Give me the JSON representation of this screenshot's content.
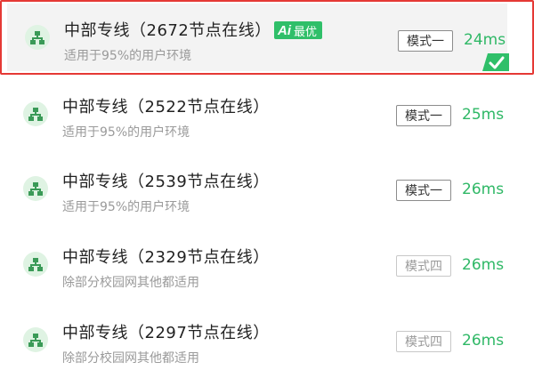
{
  "accent_color": "#2fb866",
  "selected_border_color": "#e53935",
  "lines": [
    {
      "title": "中部专线（2672节点在线）",
      "subtitle": "适用于95%的用户环境",
      "badge": {
        "mark": "Ai",
        "label": "最优"
      },
      "mode": "模式一",
      "latency": "24ms",
      "selected": true,
      "icon": "network-node-icon"
    },
    {
      "title": "中部专线（2522节点在线）",
      "subtitle": "适用于95%的用户环境",
      "mode": "模式一",
      "latency": "25ms",
      "selected": false,
      "icon": "network-node-icon"
    },
    {
      "title": "中部专线（2539节点在线）",
      "subtitle": "适用于95%的用户环境",
      "mode": "模式一",
      "latency": "26ms",
      "selected": false,
      "icon": "network-node-icon"
    },
    {
      "title": "中部专线（2329节点在线）",
      "subtitle": "除部分校园网其他都适用",
      "mode": "模式四",
      "latency": "26ms",
      "selected": false,
      "icon": "network-node-icon"
    },
    {
      "title": "中部专线（2297节点在线）",
      "subtitle": "除部分校园网其他都适用",
      "mode": "模式四",
      "latency": "26ms",
      "selected": false,
      "icon": "network-node-icon"
    }
  ]
}
